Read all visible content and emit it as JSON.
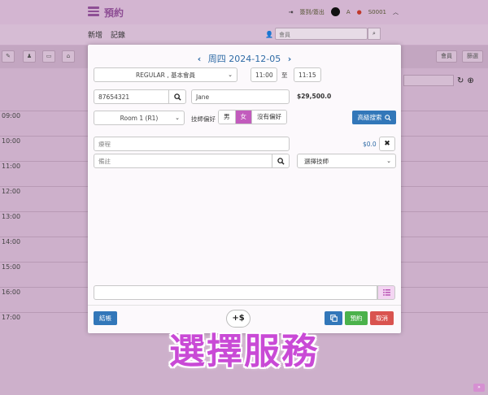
{
  "app": {
    "title": "預約"
  },
  "topbar": {
    "signin": "簽到/簽出",
    "user_initial": "A",
    "store": "S0001"
  },
  "subbar": {
    "new_label": "新增",
    "record_label": "記錄",
    "search_placeholder": "會員"
  },
  "toolbar": {
    "member_label": "會員",
    "filter_label": "篩選"
  },
  "timeslots": [
    "09:00",
    "10:00",
    "11:00",
    "12:00",
    "13:00",
    "14:00",
    "15:00",
    "16:00",
    "17:00"
  ],
  "modal": {
    "date": "周四 2024-12-05",
    "membership_select": "REGULAR , 基本會員",
    "time_from": "11:00",
    "time_to_label": "至",
    "time_to": "11:15",
    "phone": "87654321",
    "name": "Jane",
    "balance": "$29,500.0",
    "room_select": "Room 1 (R1)",
    "preference_label": "技師偏好",
    "preference_options": [
      "男",
      "女",
      "沒有偏好"
    ],
    "advanced_search_label": "高級搜索",
    "course_placeholder": "療程",
    "course_price": "$0.0",
    "remark_placeholder": "備註",
    "therapist_select": "選擇技師",
    "plus_dollar_label": "+$",
    "checkout_label": "結帳",
    "book_label": "預約",
    "cancel_label": "取消"
  },
  "caption": "選擇服務"
}
